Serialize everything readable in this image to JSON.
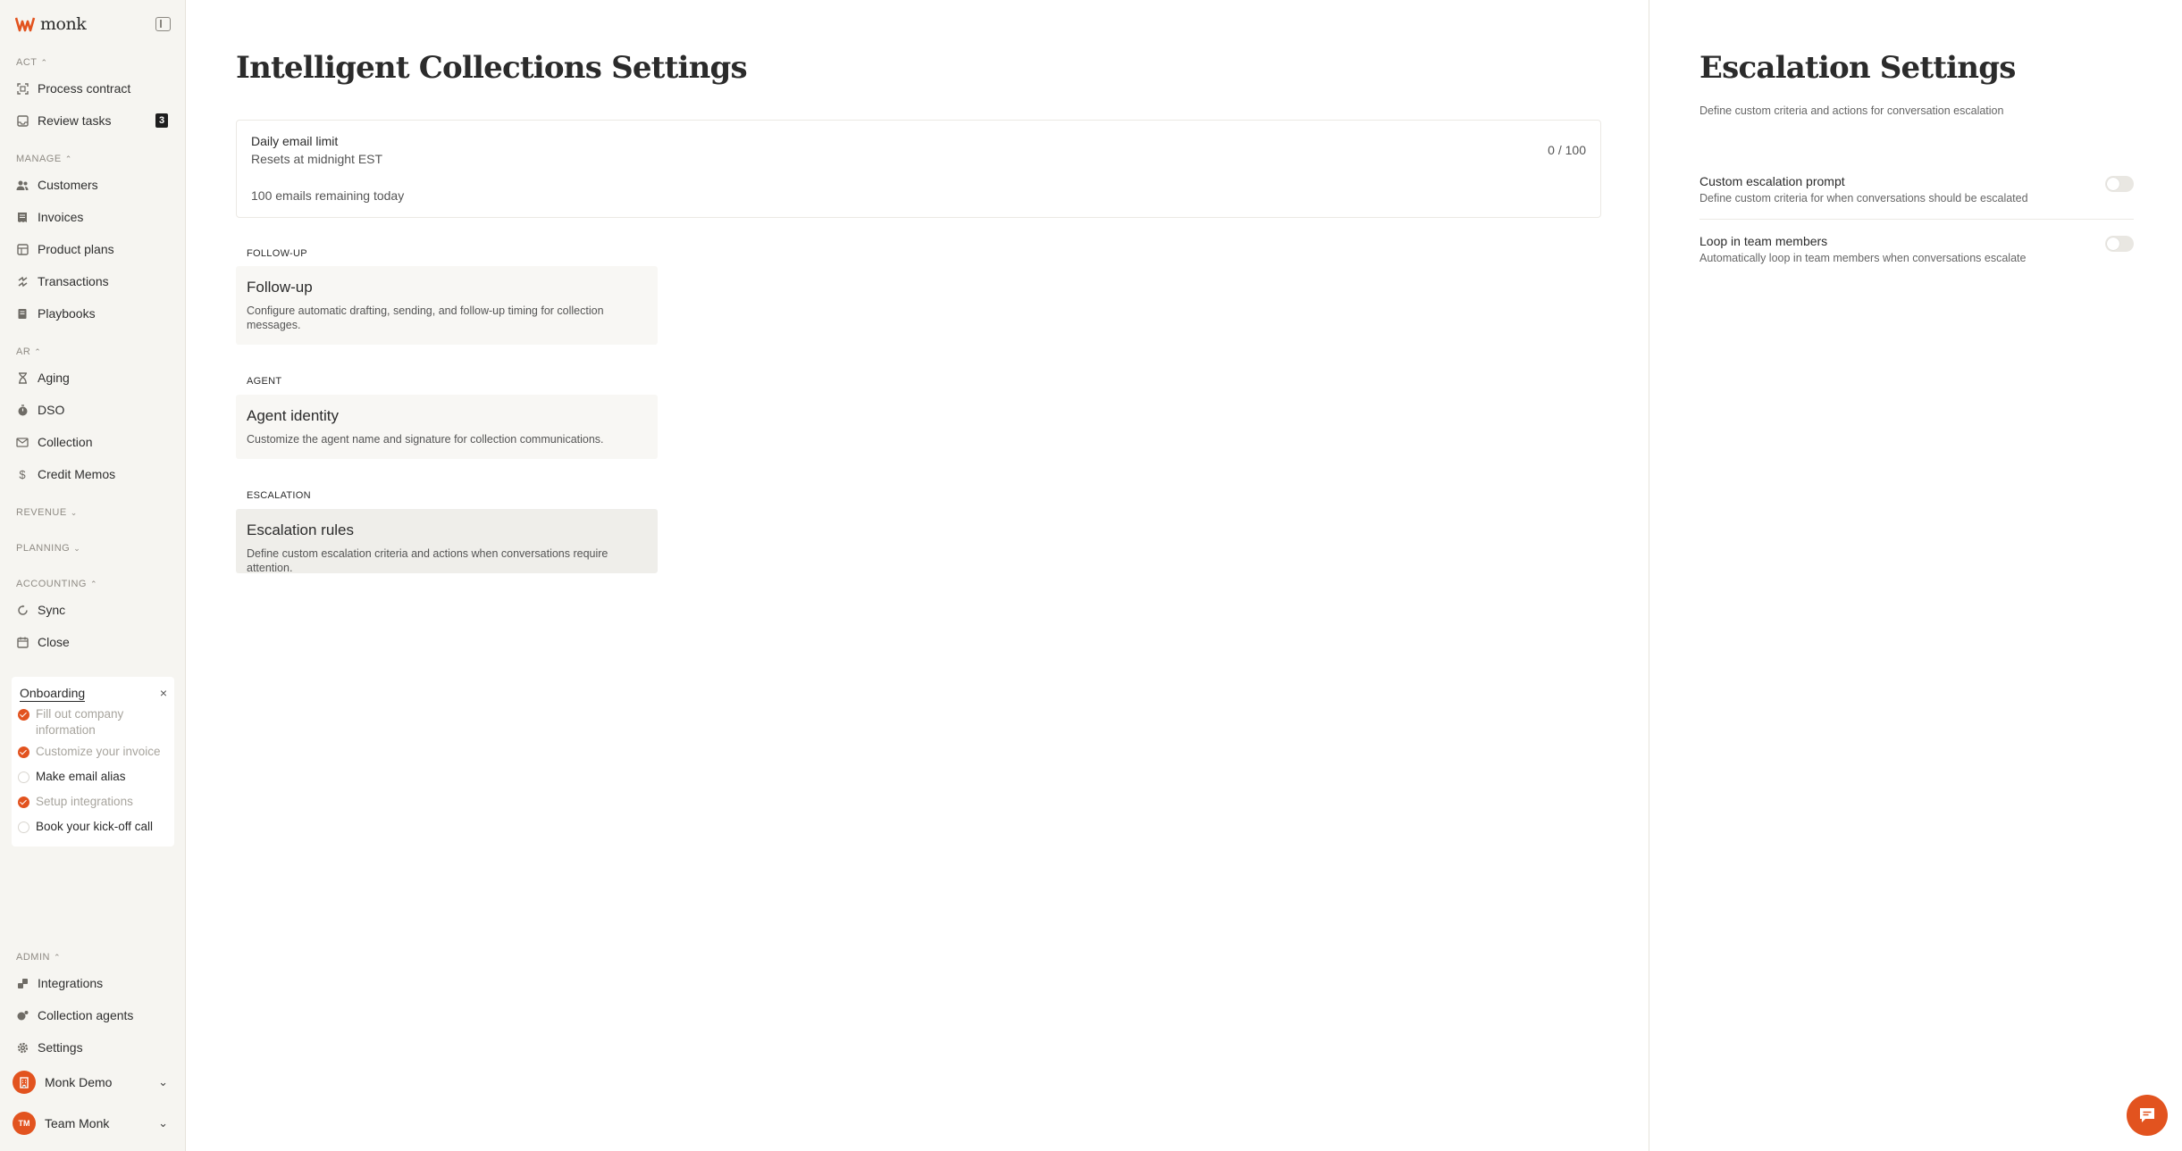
{
  "brand": {
    "name": "monk",
    "accent": "#e2531f"
  },
  "sidebar": {
    "sections": {
      "act": "ACT",
      "manage": "MANAGE",
      "ar": "AR",
      "revenue": "REVENUE",
      "planning": "PLANNING",
      "accounting": "ACCOUNTING",
      "admin": "ADMIN"
    },
    "act_items": [
      {
        "label": "Process contract",
        "icon": "document-scan-icon"
      },
      {
        "label": "Review tasks",
        "icon": "inbox-icon",
        "badge": "3"
      }
    ],
    "manage_items": [
      {
        "label": "Customers",
        "icon": "users-icon"
      },
      {
        "label": "Invoices",
        "icon": "invoice-icon"
      },
      {
        "label": "Product plans",
        "icon": "grid-icon"
      },
      {
        "label": "Transactions",
        "icon": "transactions-icon"
      },
      {
        "label": "Playbooks",
        "icon": "book-icon"
      }
    ],
    "ar_items": [
      {
        "label": "Aging",
        "icon": "hourglass-icon"
      },
      {
        "label": "DSO",
        "icon": "stopwatch-icon"
      },
      {
        "label": "Collection",
        "icon": "mail-icon"
      },
      {
        "label": "Credit Memos",
        "icon": "dollar-icon"
      }
    ],
    "accounting_items": [
      {
        "label": "Sync",
        "icon": "sync-icon"
      },
      {
        "label": "Close",
        "icon": "calendar-icon"
      }
    ],
    "admin_items": [
      {
        "label": "Integrations",
        "icon": "plug-icon"
      },
      {
        "label": "Collection agents",
        "icon": "agent-icon"
      },
      {
        "label": "Settings",
        "icon": "gear-icon"
      }
    ],
    "onboarding": {
      "title": "Onboarding",
      "close": "×",
      "items": [
        {
          "label": "Fill out company information",
          "done": true
        },
        {
          "label": "Customize your invoice",
          "done": true
        },
        {
          "label": "Make email alias",
          "done": false
        },
        {
          "label": "Setup integrations",
          "done": true
        },
        {
          "label": "Book your kick-off call",
          "done": false
        }
      ]
    },
    "accounts": [
      {
        "name": "Monk Demo",
        "initials": ""
      },
      {
        "name": "Team Monk",
        "initials": "TM"
      }
    ]
  },
  "main": {
    "title": "Intelligent Collections Settings",
    "email_limit": {
      "title": "Daily email limit",
      "reset": "Resets at midnight EST",
      "remaining": "100 emails remaining today",
      "count": "0 / 100"
    },
    "groups": [
      {
        "label": "FOLLOW-UP",
        "title": "Follow-up",
        "desc": "Configure automatic drafting, sending, and follow-up timing for collection messages."
      },
      {
        "label": "AGENT",
        "title": "Agent identity",
        "desc": "Customize the agent name and signature for collection communications."
      },
      {
        "label": "ESCALATION",
        "title": "Escalation rules",
        "desc": "Define custom escalation criteria and actions when conversations require attention."
      }
    ]
  },
  "panel": {
    "title": "Escalation Settings",
    "subtitle": "Define custom criteria and actions for conversation escalation",
    "rows": [
      {
        "title": "Custom escalation prompt",
        "desc": "Define custom criteria for when conversations should be escalated",
        "enabled": false
      },
      {
        "title": "Loop in team members",
        "desc": "Automatically loop in team members when conversations escalate",
        "enabled": false
      }
    ]
  }
}
